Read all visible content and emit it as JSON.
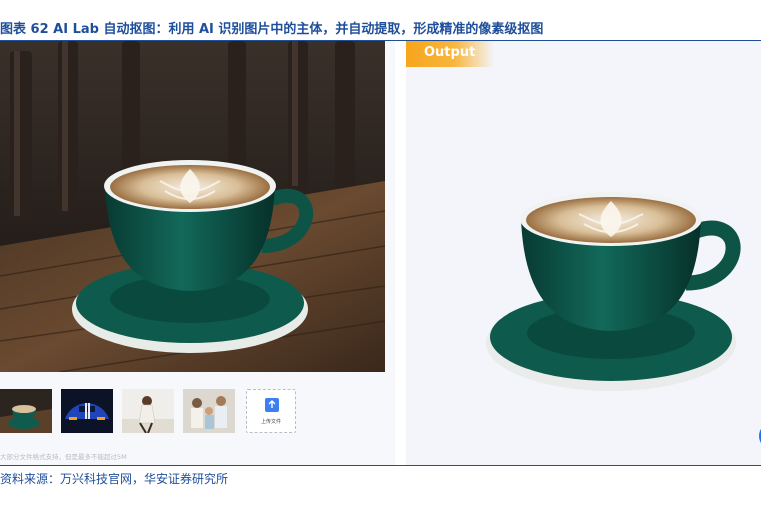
{
  "figure": {
    "title": "图表 62 AI Lab 自动抠图：利用 AI 识别图片中的主体，并自动提取，形成精准的像素级抠图",
    "source": "资料来源：万兴科技官网，华安证券研究所"
  },
  "left_panel": {
    "main_image": "coffee-cup-on-wooden-table",
    "thumbnails": [
      {
        "name": "coffee-cup"
      },
      {
        "name": "blue-sports-car"
      },
      {
        "name": "woman-on-beach"
      },
      {
        "name": "family-photo"
      }
    ],
    "upload_label": "上传文件",
    "upload_icon": "upload-icon",
    "hint_text": "大部分文件格式支持，但是最多不能超过5M"
  },
  "right_panel": {
    "badge_label": "Output",
    "result_image": "coffee-cup-cutout"
  },
  "colors": {
    "title_blue": "#1f4e9a",
    "badge_orange": "#f7a51c",
    "cup_green": "#0f5b4e",
    "float_button_blue": "#2a6ee8"
  }
}
